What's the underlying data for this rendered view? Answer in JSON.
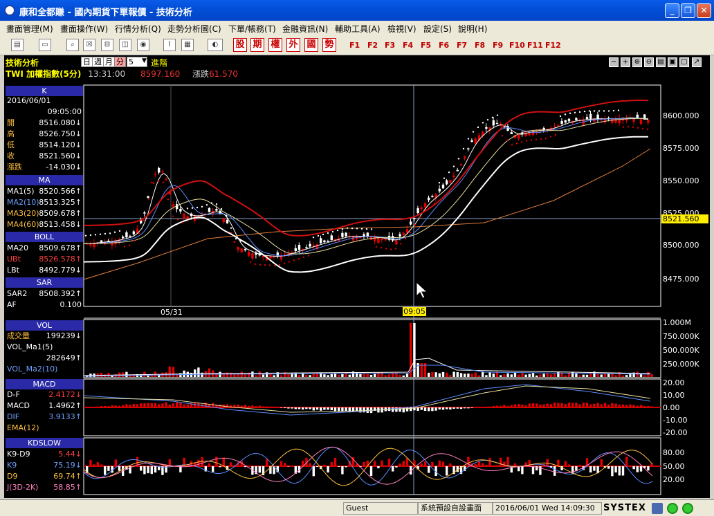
{
  "window": {
    "title": "康和全都賺 - 國內期貨下單報價 - 技術分析"
  },
  "menu": [
    "畫面管理(M)",
    "畫面操作(W)",
    "行情分析(Q)",
    "走勢分析圖(C)",
    "下單/帳務(T)",
    "金融資訊(N)",
    "輔助工具(A)",
    "檢視(V)",
    "設定(S)",
    "說明(H)"
  ],
  "toolbar": {
    "red_buttons": [
      "股",
      "期",
      "權",
      "外",
      "國",
      "勢"
    ],
    "fkeys": [
      "F1",
      "F2",
      "F3",
      "F4",
      "F5",
      "F6",
      "F7",
      "F8",
      "F9",
      "F10",
      "F11",
      "F12"
    ]
  },
  "chart_header": {
    "title": "技術分析",
    "period_tabs": [
      "日",
      "週",
      "月",
      "分"
    ],
    "selected_tab": "分",
    "interval": "5",
    "advanced": "進階",
    "symbol": "TWI  加權指數(5分)",
    "time": "13:31:00",
    "price": "8597.160",
    "change_label": "漲跌",
    "change_value": "61.570"
  },
  "left_panel": {
    "k": {
      "title": "K",
      "date": "2016/06/01",
      "time": "09:05:00",
      "rows": [
        {
          "k": "開",
          "v": "8516.080↓"
        },
        {
          "k": "高",
          "v": "8526.750↓"
        },
        {
          "k": "低",
          "v": "8514.120↓"
        },
        {
          "k": "收",
          "v": "8521.560↓"
        },
        {
          "k": "漲跌",
          "v": "-14.030↓"
        }
      ]
    },
    "ma": {
      "title": "MA",
      "rows": [
        {
          "k": "MA1(5)",
          "v": "8520.566↑"
        },
        {
          "k": "MA2(10)",
          "v": "8513.325↑"
        },
        {
          "k": "MA3(20)",
          "v": "8509.678↑"
        },
        {
          "k": "MA4(60)",
          "v": "8513.458↓"
        }
      ]
    },
    "boll": {
      "title": "BOLL",
      "rows": [
        {
          "k": "MA20",
          "v": "8509.678↑"
        },
        {
          "k": "UBt",
          "v": "8526.578↑"
        },
        {
          "k": "LBt",
          "v": "8492.779↓"
        }
      ]
    },
    "sar": {
      "title": "SAR",
      "rows": [
        {
          "k": "SAR2",
          "v": "8508.392↑"
        },
        {
          "k": "AF",
          "v": "0.100"
        }
      ]
    },
    "vol": {
      "title": "VOL",
      "rows": [
        {
          "k": "成交量",
          "v": "199239↓"
        },
        {
          "k": "VOL_Ma1(5)",
          "v": ""
        },
        {
          "k": "",
          "v": "282649↑"
        },
        {
          "k": "VOL_Ma2(10)",
          "v": ""
        }
      ]
    },
    "macd": {
      "title": "MACD",
      "rows": [
        {
          "k": "D-F",
          "v": "2.4172↓"
        },
        {
          "k": "MACD",
          "v": "1.4962↑"
        },
        {
          "k": "DIF",
          "v": "3.9133↑"
        },
        {
          "k": "EMA(12)",
          "v": ""
        }
      ]
    },
    "kd": {
      "title": "KDSLOW",
      "rows": [
        {
          "k": "K9-D9",
          "v": "5.44↓"
        },
        {
          "k": "K9",
          "v": "75.19↓"
        },
        {
          "k": "D9",
          "v": "69.74↑"
        },
        {
          "k": "J(3D-2K)",
          "v": "58.85↑"
        }
      ]
    }
  },
  "price_axis": [
    "8600.000",
    "8575.000",
    "8550.000",
    "8525.000",
    "8500.000",
    "8475.000"
  ],
  "current_price_tag": "8521.560",
  "date_marker": "05/31",
  "cursor_time": "09:05",
  "vol_axis": [
    "1.000M",
    "750.000K",
    "500.000K",
    "250.000K"
  ],
  "macd_axis": [
    "20.00",
    "10.00",
    "0.00",
    "-10.00",
    "-20.00"
  ],
  "kd_axis": [
    "80.00",
    "50.00",
    "20.00"
  ],
  "status": {
    "user": "Guest",
    "layout": "系統預設自設畫面",
    "datetime": "2016/06/01 Wed 14:09:30",
    "brand": "SYSTEX"
  },
  "colors": {
    "up": "#d00000",
    "down": "#ffffff",
    "boll": "#cc1111",
    "ma": "#e8e0a0",
    "panel_header": "#2a2aa8"
  }
}
